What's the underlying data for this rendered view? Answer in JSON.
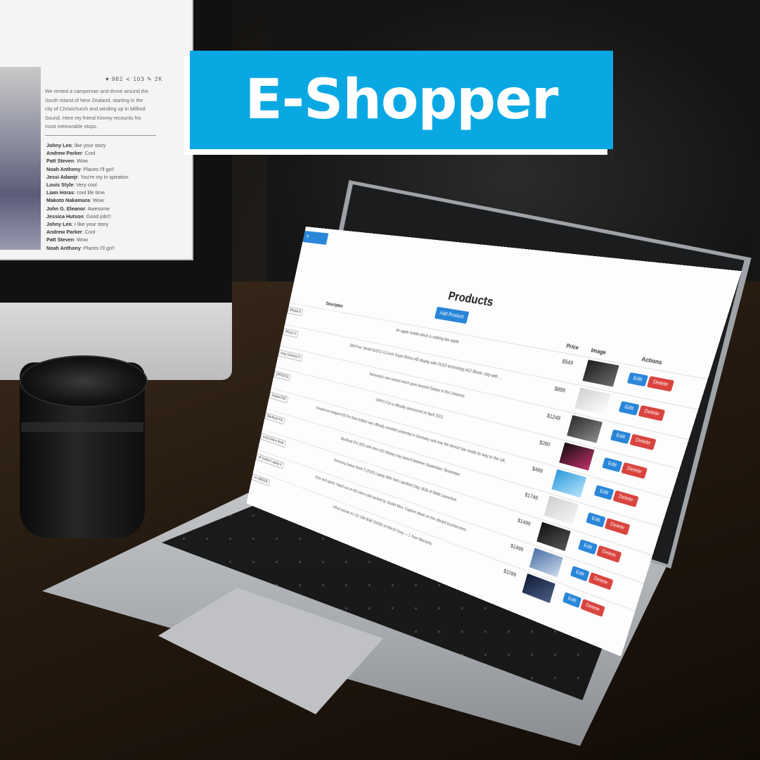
{
  "banner": {
    "title": "E-Shopper"
  },
  "blog": {
    "stats": "♥ 982  ≺ 103  ✎ 2K",
    "text": "We rented a campervan and drove around the South Island of New Zealand, starting in the city of Christchurch and winding up in Milford Sound. Here my friend Kimmy recounts his most memorable stops.",
    "comments": [
      {
        "author": "Johny Leo",
        "text": ": like your story"
      },
      {
        "author": "Andrew Parker",
        "text": ": Cool"
      },
      {
        "author": "Patt Steven",
        "text": ": Wow"
      },
      {
        "author": "Noah Antheny",
        "text": ": Places I'll go!!"
      },
      {
        "author": "Jessi Adamjr",
        "text": ": You're my in spiration"
      },
      {
        "author": "Louis Style",
        "text": ": Very cool"
      },
      {
        "author": "Liam Horas",
        "text": ": cool life time"
      },
      {
        "author": "Makoto Nakamura",
        "text": ": Wow"
      },
      {
        "author": "John G. Eleanor",
        "text": ": Awesome"
      },
      {
        "author": "Jessica Hutson",
        "text": ": Good job!!!"
      },
      {
        "author": "Johny Leo",
        "text": ": I like your story"
      },
      {
        "author": "Andrew Parker",
        "text": ": Cool"
      },
      {
        "author": "Patt Steven",
        "text": ": Wow"
      },
      {
        "author": "Noah Anthony",
        "text": ": Places I'll go!!"
      }
    ]
  },
  "app": {
    "nav_label": "e",
    "page_title": "Products",
    "add_button": "Add Product",
    "columns": {
      "description": "Descriptior",
      "price": "Price",
      "image": "Image",
      "actions": "Actions"
    },
    "edit_label": "Edit",
    "delete_label": "Delete",
    "products": [
      {
        "name": "iPhone 8",
        "description": "An apple mobile which is nothing like apple",
        "price": "$549"
      },
      {
        "name": "iPhone X",
        "description": "SIM-Free, Model A19211 6.5-inch Super Retina HD display with OLED technology A12 Bionic chip with ...",
        "price": "$899"
      },
      {
        "name": "sung Universe 9",
        "description": "Samsung's new variant which goes beyond Galaxy to the Universe",
        "price": "$1249"
      },
      {
        "name": "OPPOF19",
        "description": "OPPO F19 is officially announced on April 2021.",
        "price": "$280"
      },
      {
        "name": "Huawei P30",
        "description": "Huawei’ere-badged P30 Pro New Edition was officially unveiled yesterday in Germany and now the device has made its way to the UK.",
        "price": "$499"
      },
      {
        "name": "MacBook Pro",
        "description": "MacBook Pro 2021 with mini-LED display may launch between September, November",
        "price": "$1749"
      },
      {
        "name": "sung Galaxy Book",
        "description": "Samsung Galaxy Book S (2020) Laptop With Intel Lakefield Chip, 8GB of RAM Launched",
        "price": "$1499"
      },
      {
        "name": "oft Surface Laptop 4",
        "description": "Style and speed. Stand out on HD video calls backed by Studio Mics. Capture ideas on the vibrant touchscreen.",
        "price": "$1499"
      },
      {
        "name": "nix INBOOK",
        "description": "Infinix Inbook X1 Ci3 10th 8GB 256GB 14 Win10 Grey — 1 Year Warranty",
        "price": "$1099"
      }
    ]
  },
  "colors": {
    "banner": "#0aa8e3",
    "primary": "#2a86d8",
    "danger": "#d9443f"
  }
}
